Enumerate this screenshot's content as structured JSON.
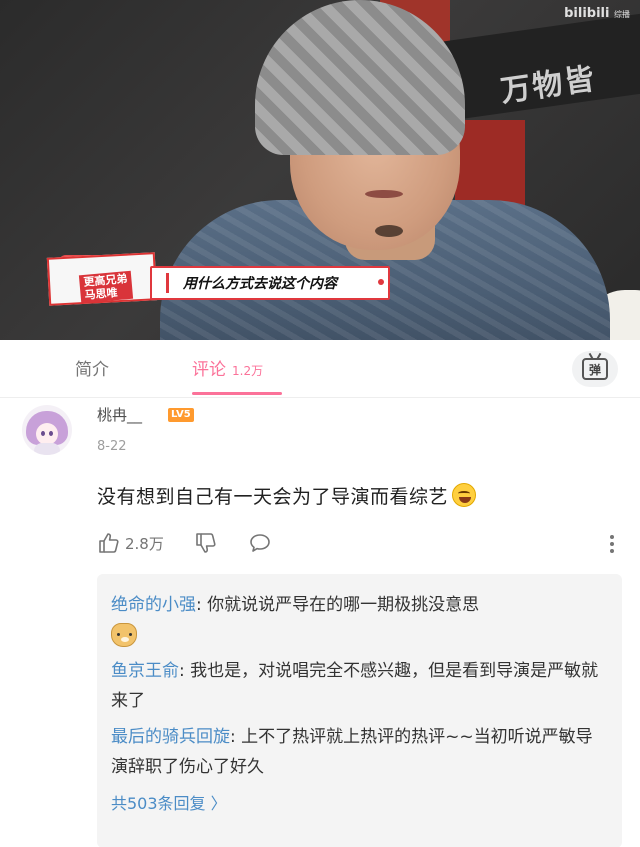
{
  "video": {
    "caption_tag": "更高兄弟\n马思唯",
    "caption_text": "用什么方式去说这个内容",
    "watermark": "bilibili",
    "watermark_sub": "综播",
    "background_sign": "万物皆"
  },
  "tabs": [
    {
      "label": "简介",
      "active": false
    },
    {
      "label": "评论",
      "count": "1.2万",
      "active": true
    }
  ],
  "danmaku_button": {
    "label": "弹"
  },
  "comment": {
    "username": "桃冉__",
    "level": "LV5",
    "date": "8-22",
    "text": "没有想到自己有一天会为了导演而看综艺",
    "likes": "2.8万"
  },
  "replies": [
    {
      "user": "绝命的小强",
      "text": ": 你就说说严导在的哪一期极挑没意思"
    },
    {
      "user": "鱼京王俞",
      "text": ": 我也是，对说唱完全不感兴趣，但是看到导演是严敏就来了"
    },
    {
      "user": "最后的骑兵回旋",
      "text": ": 上不了热评就上热评的热评~~当初听说严敏导演辞职了伤心了好久"
    }
  ],
  "replies_total": "共503条回复 〉",
  "colors": {
    "accent": "#fb7299",
    "link": "#4b8cc6",
    "level": "#ff9a2e"
  }
}
